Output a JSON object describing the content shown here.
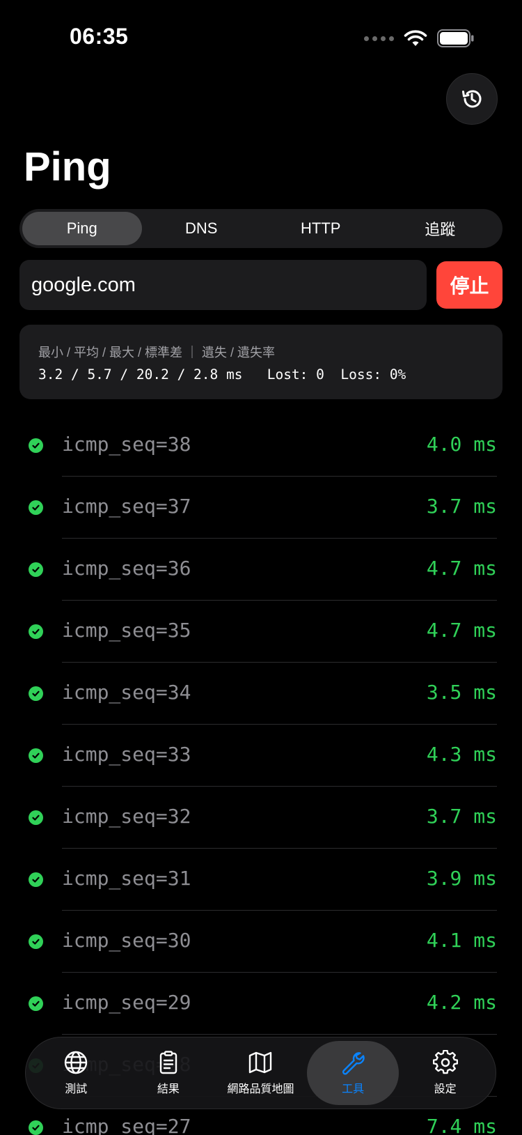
{
  "status_bar": {
    "time": "06:35"
  },
  "page": {
    "title": "Ping"
  },
  "segments": [
    {
      "label": "Ping",
      "active": true
    },
    {
      "label": "DNS",
      "active": false
    },
    {
      "label": "HTTP",
      "active": false
    },
    {
      "label": "追蹤",
      "active": false
    }
  ],
  "host_input": {
    "value": "google.com"
  },
  "stop_button": {
    "label": "停止"
  },
  "stats": {
    "label": "最小 / 平均 / 最大 / 標準差 ｜ 遺失 / 遺失率",
    "values": "3.2 / 5.7 / 20.2 / 2.8 ms   Lost: 0  Loss: 0%"
  },
  "pings": [
    {
      "seq": "icmp_seq=38",
      "rtt": "4.0 ms"
    },
    {
      "seq": "icmp_seq=37",
      "rtt": "3.7 ms"
    },
    {
      "seq": "icmp_seq=36",
      "rtt": "4.7 ms"
    },
    {
      "seq": "icmp_seq=35",
      "rtt": "4.7 ms"
    },
    {
      "seq": "icmp_seq=34",
      "rtt": "3.5 ms"
    },
    {
      "seq": "icmp_seq=33",
      "rtt": "4.3 ms"
    },
    {
      "seq": "icmp_seq=32",
      "rtt": "3.7 ms"
    },
    {
      "seq": "icmp_seq=31",
      "rtt": "3.9 ms"
    },
    {
      "seq": "icmp_seq=30",
      "rtt": "4.1 ms"
    },
    {
      "seq": "icmp_seq=29",
      "rtt": "4.2 ms"
    },
    {
      "seq": "icmp_seq=28",
      "rtt": ""
    },
    {
      "seq": "icmp_seq=27",
      "rtt": "7.4 ms"
    }
  ],
  "tab_bar": {
    "tabs": [
      {
        "label": "測試",
        "icon": "globe-icon"
      },
      {
        "label": "結果",
        "icon": "clipboard-icon"
      },
      {
        "label": "網路品質地圖",
        "icon": "map-icon"
      },
      {
        "label": "工具",
        "icon": "wrench-icon",
        "active": true
      },
      {
        "label": "設定",
        "icon": "gear-icon"
      }
    ]
  },
  "colors": {
    "accent": "#0a84ff",
    "success": "#30d158",
    "danger": "#ff453a"
  }
}
